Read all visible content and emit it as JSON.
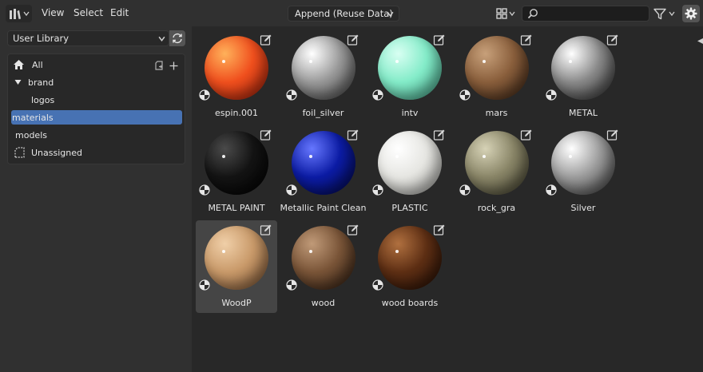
{
  "header": {
    "menu": [
      "View",
      "Select",
      "Edit"
    ],
    "import_method": "Append (Reuse Data)",
    "search_placeholder": "",
    "icons": [
      "editor-type-icon",
      "chevron-down-icon",
      "display-mode-icon",
      "search-icon",
      "filter-icon",
      "gear-icon"
    ]
  },
  "sidebar": {
    "library": "User Library",
    "catalogs": [
      {
        "label": "All",
        "level": 0,
        "icon": "home-icon"
      },
      {
        "label": "brand",
        "level": 0,
        "icon": "expand-arrow-icon"
      },
      {
        "label": "logos",
        "level": 1
      },
      {
        "label": "materials",
        "level": 0,
        "selected": true
      },
      {
        "label": "models",
        "level": 0
      },
      {
        "label": "Unassigned",
        "level": 0,
        "icon": "unassigned-icon"
      }
    ]
  },
  "assets": [
    {
      "name": "espin.001",
      "colors": [
        "#ffb15a",
        "#f0501e",
        "#a01e0a"
      ]
    },
    {
      "name": "foil_silver",
      "colors": [
        "#ffffff",
        "#9a9a9a",
        "#404040"
      ]
    },
    {
      "name": "intv",
      "colors": [
        "#d8fff2",
        "#84ecc9",
        "#3f9b80"
      ]
    },
    {
      "name": "mars",
      "colors": [
        "#c7a07a",
        "#8a5f3c",
        "#3b2414"
      ]
    },
    {
      "name": "METAL",
      "colors": [
        "#ffffff",
        "#8a8a8a",
        "#2b2b2b"
      ]
    },
    {
      "name": "METAL PAINT",
      "colors": [
        "#4a4a4a",
        "#141414",
        "#000000"
      ]
    },
    {
      "name": "Metallic Paint Clean",
      "colors": [
        "#6677ff",
        "#0c1ca5",
        "#02084a"
      ]
    },
    {
      "name": "PLASTIC",
      "colors": [
        "#ffffff",
        "#e6e6e2",
        "#9d9d99"
      ]
    },
    {
      "name": "rock_gra",
      "colors": [
        "#d6d2b6",
        "#8a8668",
        "#3f3d2c"
      ]
    },
    {
      "name": "Silver",
      "colors": [
        "#ffffff",
        "#9d9d9d",
        "#3a3a3a"
      ]
    },
    {
      "name": "WoodP",
      "colors": [
        "#f0cfa8",
        "#c99a6a",
        "#7a5232"
      ],
      "selected": true
    },
    {
      "name": "wood",
      "colors": [
        "#c09a78",
        "#7a5538",
        "#2e1c10"
      ]
    },
    {
      "name": "wood boards",
      "colors": [
        "#b0703f",
        "#5e2f14",
        "#220d04"
      ]
    }
  ]
}
